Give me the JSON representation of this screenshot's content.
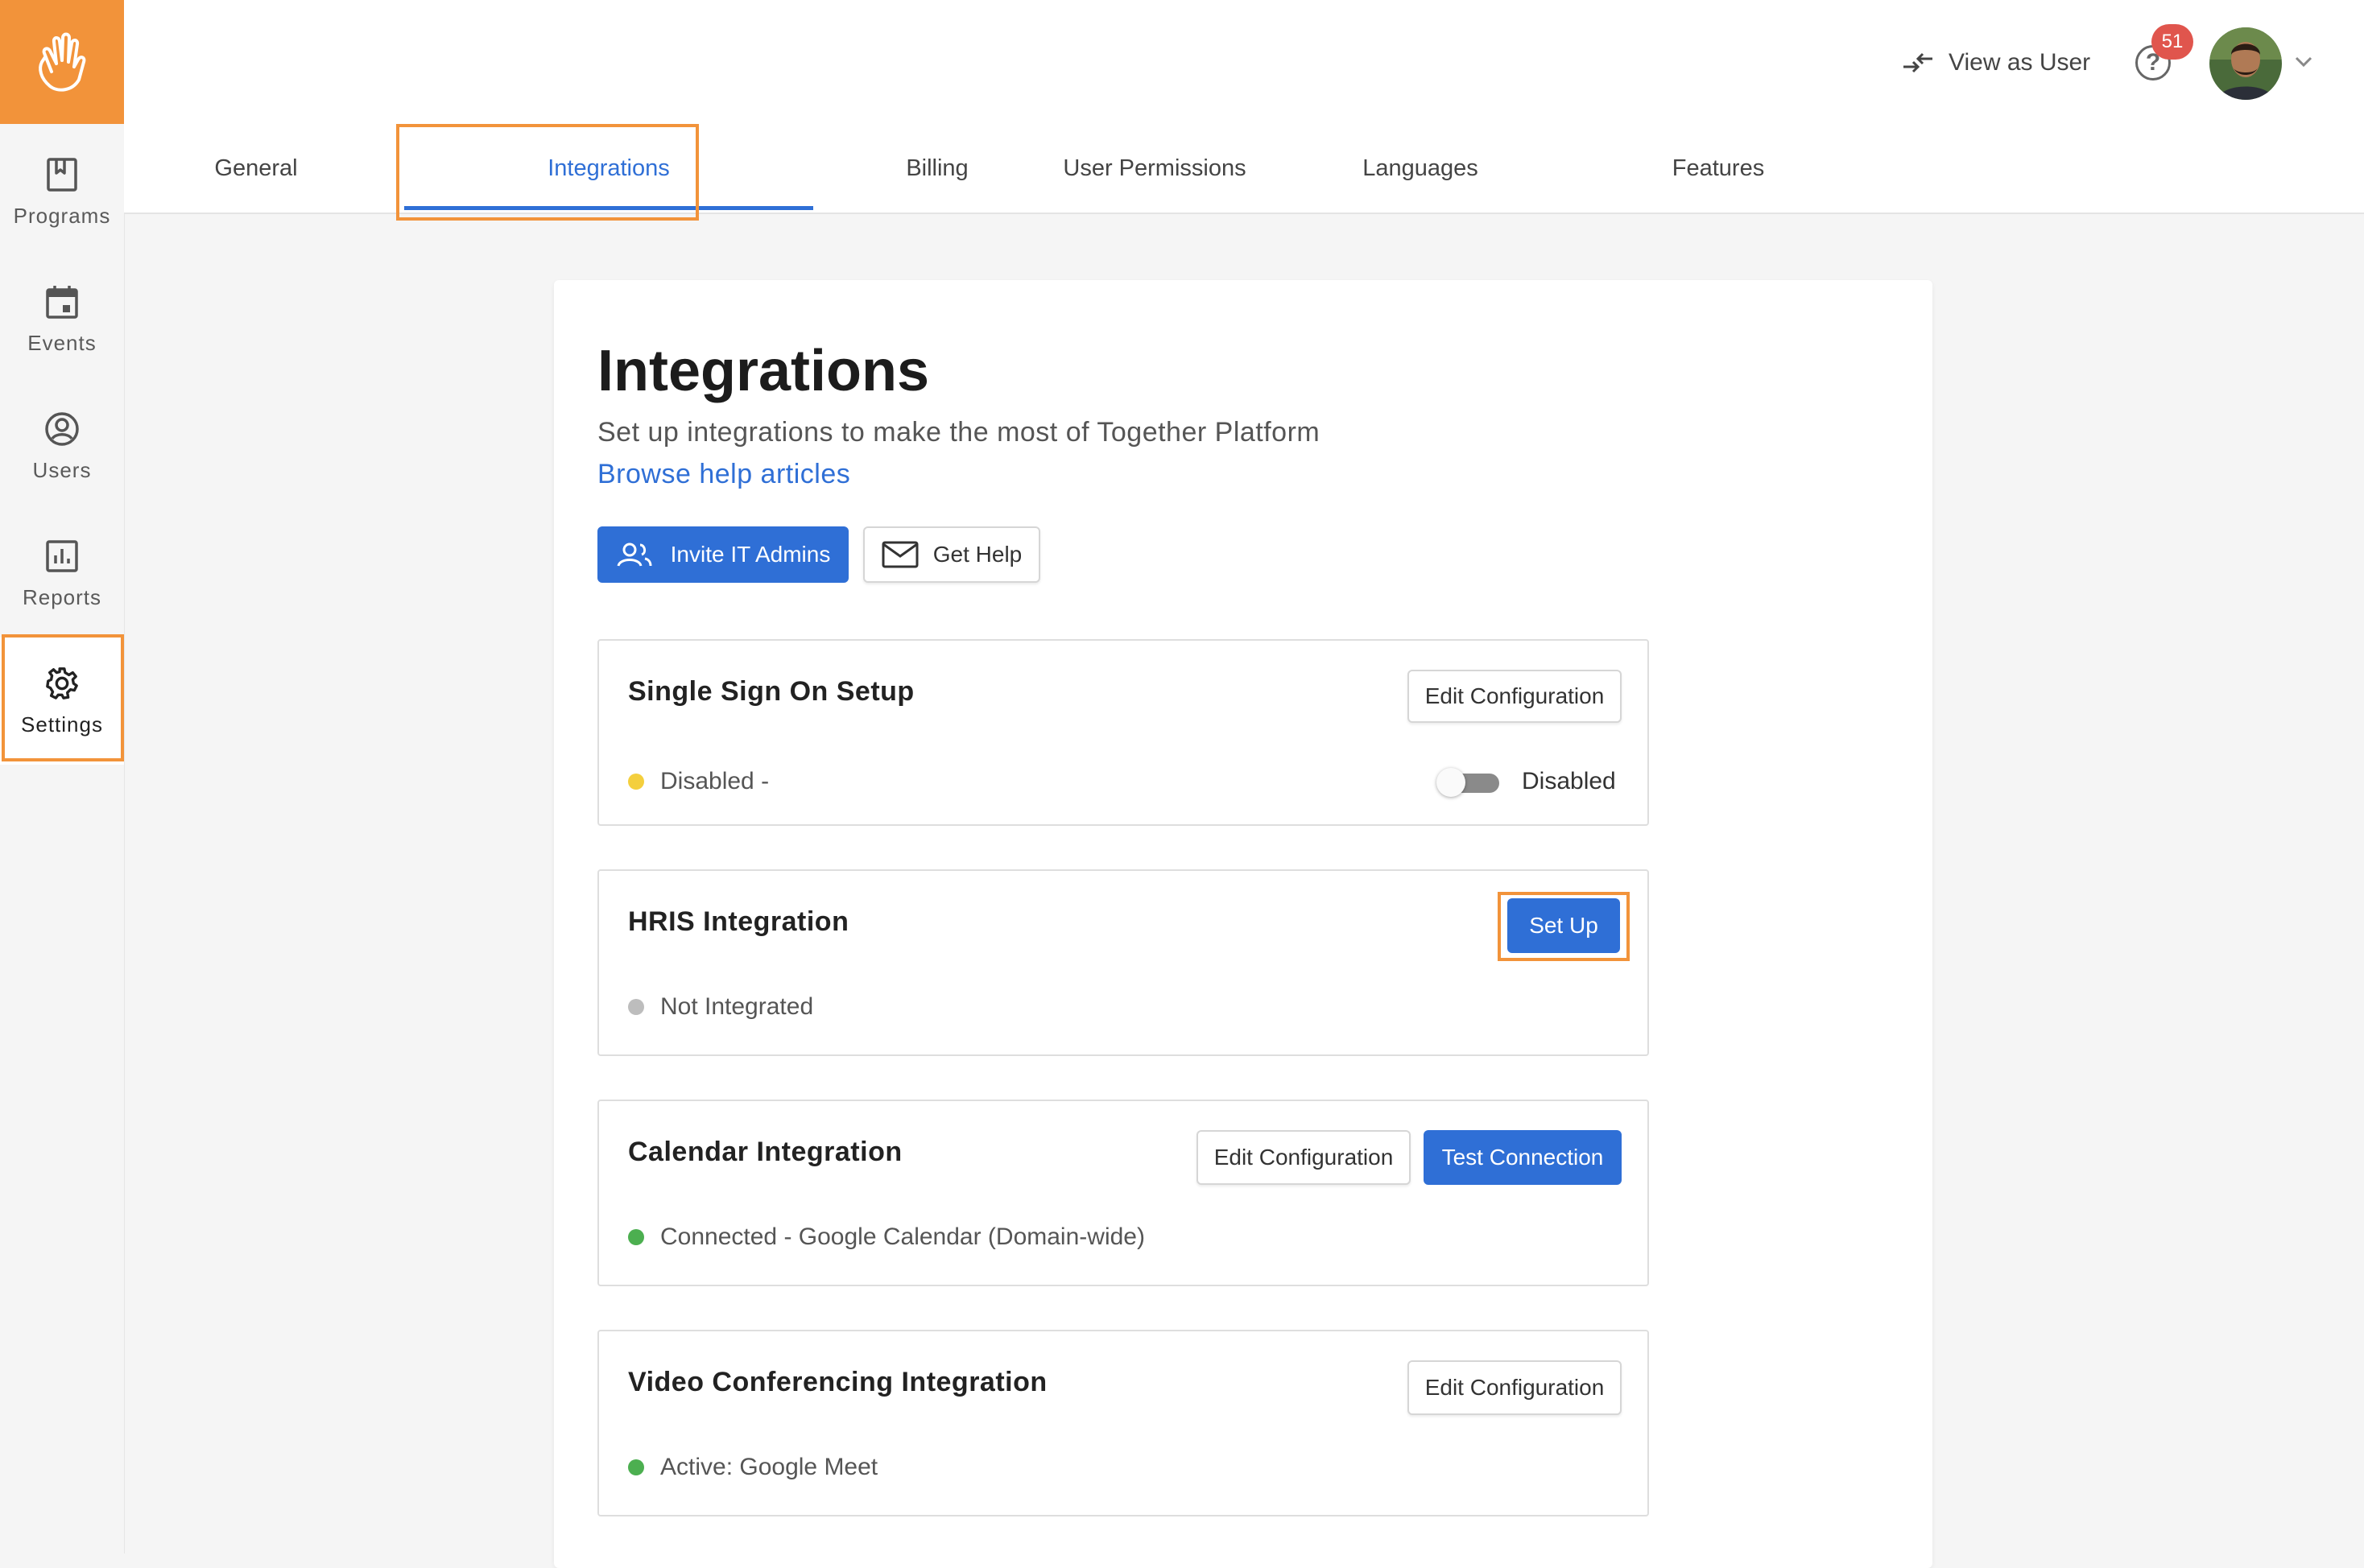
{
  "sidebar": {
    "items": [
      {
        "label": "Programs",
        "icon": "bookmark-icon"
      },
      {
        "label": "Events",
        "icon": "calendar-icon"
      },
      {
        "label": "Users",
        "icon": "user-circle-icon"
      },
      {
        "label": "Reports",
        "icon": "chart-icon"
      },
      {
        "label": "Settings",
        "icon": "gear-icon",
        "active": true
      }
    ]
  },
  "header": {
    "view_as_user": "View as User",
    "help_badge": "51"
  },
  "tabs": [
    {
      "label": "General"
    },
    {
      "label": "Integrations",
      "active": true
    },
    {
      "label": "Billing"
    },
    {
      "label": "User Permissions"
    },
    {
      "label": "Languages"
    },
    {
      "label": "Features"
    }
  ],
  "page": {
    "title": "Integrations",
    "subtitle": "Set up integrations to make the most of Together Platform",
    "help_link": "Browse help articles",
    "invite_button": "Invite IT Admins",
    "get_help_button": "Get Help"
  },
  "sections": {
    "sso": {
      "title": "Single Sign On Setup",
      "button": "Edit Configuration",
      "status": "Disabled -",
      "toggle_label": "Disabled",
      "status_color": "#f4cf3d"
    },
    "hris": {
      "title": "HRIS Integration",
      "button": "Set Up",
      "status": "Not Integrated",
      "status_color": "#bdbdbd"
    },
    "calendar": {
      "title": "Calendar Integration",
      "edit_button": "Edit Configuration",
      "test_button": "Test Connection",
      "status": "Connected - Google Calendar (Domain-wide)",
      "status_color": "#4caf50"
    },
    "video": {
      "title": "Video Conferencing Integration",
      "button": "Edit Configuration",
      "status": "Active: Google Meet",
      "status_color": "#4caf50"
    }
  },
  "colors": {
    "brand": "#f2933a",
    "accent": "#2f6fd6",
    "highlight": "#f2933a"
  }
}
